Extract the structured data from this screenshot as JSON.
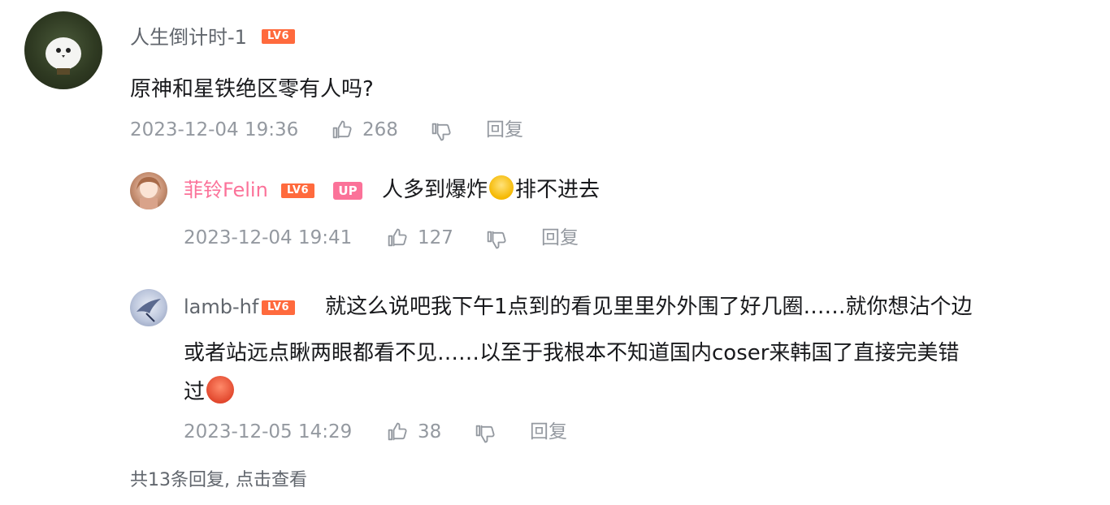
{
  "main_comment": {
    "username": "人生倒计时-1",
    "level": "LV6",
    "text": "原神和星铁绝区零有人吗?",
    "timestamp": "2023-12-04 19:36",
    "likes": "268",
    "reply_label": "回复"
  },
  "replies": [
    {
      "username": "菲铃Felin",
      "level": "LV6",
      "badge": "UP",
      "text_before_emoji": "人多到爆炸",
      "emoji": "laugh-cry-emoji",
      "text_after_emoji": "排不进去",
      "timestamp": "2023-12-04 19:41",
      "likes": "127",
      "reply_label": "回复"
    },
    {
      "username": "lamb-hf",
      "level": "LV6",
      "line1": "就这么说吧我下午1点到的看见里里外外围了好几圈……就你想沾个边",
      "line2": "或者站远点瞅两眼都看不见……以至于我根本不知道国内coser来韩国了直接完美错",
      "line3": "过",
      "emoji": "crying-face-emoji",
      "timestamp": "2023-12-05 14:29",
      "likes": "38",
      "reply_label": "回复"
    }
  ],
  "footer": {
    "text": "共13条回复, 点击查看"
  },
  "colors": {
    "accent_pink": "#fb7299",
    "level_badge": "#ff6a3d",
    "meta_gray": "#9499a0"
  }
}
